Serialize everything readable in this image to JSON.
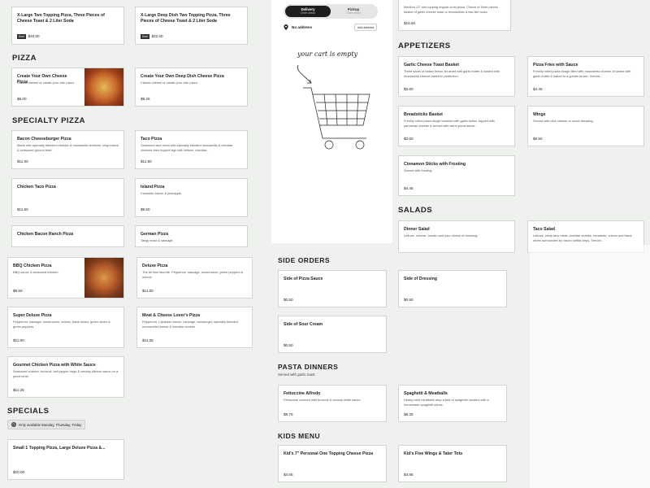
{
  "order_toggle": {
    "delivery": {
      "label": "Delivery",
      "sub": "Order ahead"
    },
    "pickup": {
      "label": "Pickup",
      "sub": "Order ahead"
    }
  },
  "address": {
    "label": "No address",
    "button": "Add address"
  },
  "cart": {
    "empty_text": "your cart is empty"
  },
  "sections": {
    "pizza": "Pizza",
    "specialty": "Specialty Pizza",
    "specials": "Specials",
    "appetizers": "Appetizers",
    "salads": "Salads",
    "side_orders": "Side Orders",
    "pasta_dinners": "Pasta Dinners",
    "pasta_sub": "Served with garlic toast.",
    "kids_menu": "Kids Menu"
  },
  "specials_tag": "Only available Monday, Thursday, Friday",
  "deal_badge": "Deal",
  "items": {
    "two_topping_1": {
      "title": "X-Large Two Topping Pizza, Three Pieces of Cheese Toast & 2 Liter Soda",
      "price": "$20.00"
    },
    "deep_dish_two": {
      "title": "X-Large Deep Dish Two Topping Pizza, Three Pieces of Cheese Toast & 2 Liter Soda",
      "price": "$22.00"
    },
    "create_cheese": {
      "title": "Create Your Own Cheese Pizza",
      "desc": "Classic cheese or create your own pizza.",
      "price": "$8.00"
    },
    "create_deep": {
      "title": "Create Your Own Deep Dish Cheese Pizza",
      "desc": "Classic cheese or create your own pizza.",
      "price": "$9.25"
    },
    "bacon_cheeseburger": {
      "title": "Bacon Cheeseburger Pizza",
      "desc": "Made with specially blended cheddar & mozzarella cheeses, crisp bacon & seasoned ground beef.",
      "price": "$11.00"
    },
    "taco_pizza": {
      "title": "Taco Pizza",
      "desc": "Seasoned taco meat with specially blended mozzarella & cheddar cheeses then topped high with lettuce, cheddar...",
      "price": "$11.50"
    },
    "chicken_taco": {
      "title": "Chicken Taco Pizza",
      "desc": "",
      "price": "$11.50"
    },
    "island_pizza": {
      "title": "Island Pizza",
      "desc": "Canadian bacon & pineapple.",
      "price": "$9.50"
    },
    "chicken_bacon_ranch": {
      "title": "Chicken Bacon Ranch Pizza",
      "desc": "",
      "price": ""
    },
    "german_pizza": {
      "title": "German Pizza",
      "desc": "Tangy kraut & sausage.",
      "price": ""
    },
    "bbq_chicken": {
      "title": "BBQ Chicken Pizza",
      "desc": "BBQ sauce & seasoned chicken.",
      "price": "$9.50"
    },
    "deluxe_pizza": {
      "title": "Deluxe Pizza",
      "desc": "The all time favorite. Pepperoni, sausage, mushrooms, green peppers & onions.",
      "price": "$11.00"
    },
    "super_deluxe": {
      "title": "Super Deluxe Pizza",
      "desc": "Pepperoni, sausage, mushrooms, onions, black olives, green olives & green peppers.",
      "price": "$11.00"
    },
    "meat_cheese": {
      "title": "Meat & Cheese Lover's Pizza",
      "desc": "Pepperoni, Canadian bacon, sausage, hamburger, specially blended mozzarella cheese & cheddar cheese.",
      "price": "$11.25"
    },
    "gourmet_chicken": {
      "title": "Gourmet Chicken Pizza with White Sauce",
      "desc": "Seasoned chicken, broccoli, bell pepper rings & creamy Alfredo sauce on a pizza crust.",
      "price": "$11.25"
    },
    "small_1_topping": {
      "title": "Small 1 Topping Pizza, Large Deluxe Pizza &...",
      "price": "$20.00"
    },
    "top_appetizer": {
      "title": "",
      "desc": "Medium 12\" one topping regular crust pizza. Choice of three pieces basket of garlic cheese toast or breadsticks & two-liter soda.",
      "price": "$16.50"
    },
    "garlic_cheese_toast": {
      "title": "Garlic Cheese Toast Basket",
      "desc": "Three slices of Italian bread, brushed with garlic butter & loaded with mozzarella cheese baked to perfection.",
      "price": "$3.60"
    },
    "pizza_fries": {
      "title": "Pizza Fries with Sauce",
      "desc": "Freshly rolled pizza dough filled with mozzarella cheese, brushed with garlic butter & baked to a golden brown. Served...",
      "price": "$4.45"
    },
    "breadsticks": {
      "title": "Breadsticks Basket",
      "desc": "Freshly rolled pizza dough brushed with garlic butter, topped with parmesan cheese & served with warm pizza sauce.",
      "price": "$3.60"
    },
    "wings": {
      "title": "Wings",
      "desc": "Served with blue cheese or ranch dressing.",
      "price": "$6.50"
    },
    "cinnamon_sticks": {
      "title": "Cinnamon Sticks with Frosting",
      "desc": "Served with frosting.",
      "price": "$4.45"
    },
    "dinner_salad": {
      "title": "Dinner Salad",
      "desc": "Lettuce, cheese, tomato and your choice of dressing.",
      "price": ""
    },
    "taco_salad": {
      "title": "Taco Salad",
      "desc": "Lettuce, zesty taco meat, cheddar cheese, tomatoes, onions and black olives surrounded by nacho tortilla chips. Served...",
      "price": ""
    },
    "side_pizza_sauce": {
      "title": "Side of Pizza Sauce",
      "price": "$0.50"
    },
    "side_dressing": {
      "title": "Side of Dressing",
      "price": "$0.50"
    },
    "side_sour_cream": {
      "title": "Side of Sour Cream",
      "price": "$0.50"
    },
    "fettuccine": {
      "title": "Fettuccine Alfredo",
      "desc": "Fettuccine covered with broccoli & creamy white sauce.",
      "price": "$8.75"
    },
    "spaghetti": {
      "title": "Spaghetti & Meatballs",
      "desc": "Hearty beef meatballs atop a bed of spaghetti noodles with a homemade spaghetti sauce.",
      "price": "$8.25"
    },
    "kids_pizza": {
      "title": "Kid's 7\" Personal One Topping Cheese Pizza",
      "price": "$4.65"
    },
    "kids_wings": {
      "title": "Kid's Five Wings & Tater Tots",
      "price": "$4.85"
    }
  }
}
